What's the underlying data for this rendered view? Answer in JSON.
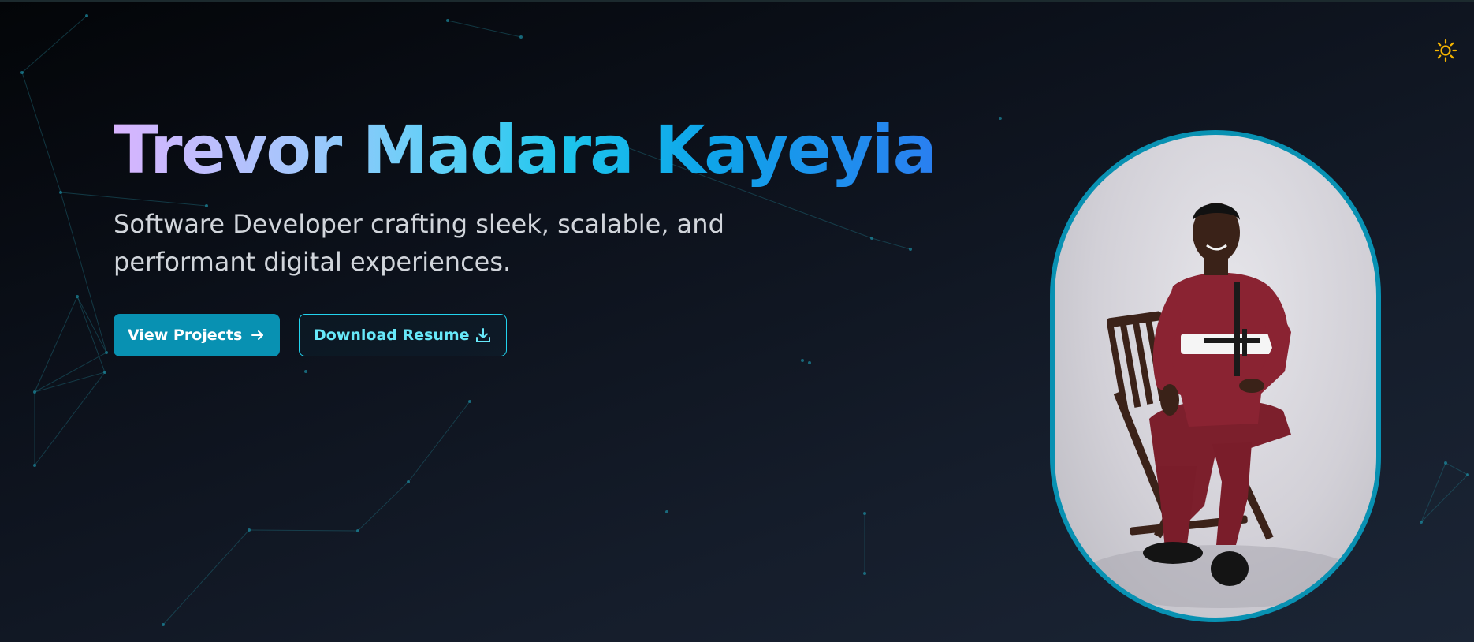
{
  "header": {
    "theme_toggle_icon": "sun-icon",
    "accent_color": "#f5b400"
  },
  "hero": {
    "title": "Trevor Madara Kayeyia",
    "subtitle": "Software Developer crafting sleek, scalable, and performant digital experiences.",
    "primary_button": {
      "label": "View Projects",
      "icon": "arrow-right-icon"
    },
    "secondary_button": {
      "label": "Download Resume",
      "icon": "download-icon"
    }
  },
  "portrait": {
    "alt": "Portrait photo of a man in a maroon outfit seated on a wooden folding chair",
    "frame_color": "#0891b2"
  },
  "colors": {
    "background": "#0c111b",
    "accent": "#0891b2",
    "accent_light": "#22d3ee"
  }
}
